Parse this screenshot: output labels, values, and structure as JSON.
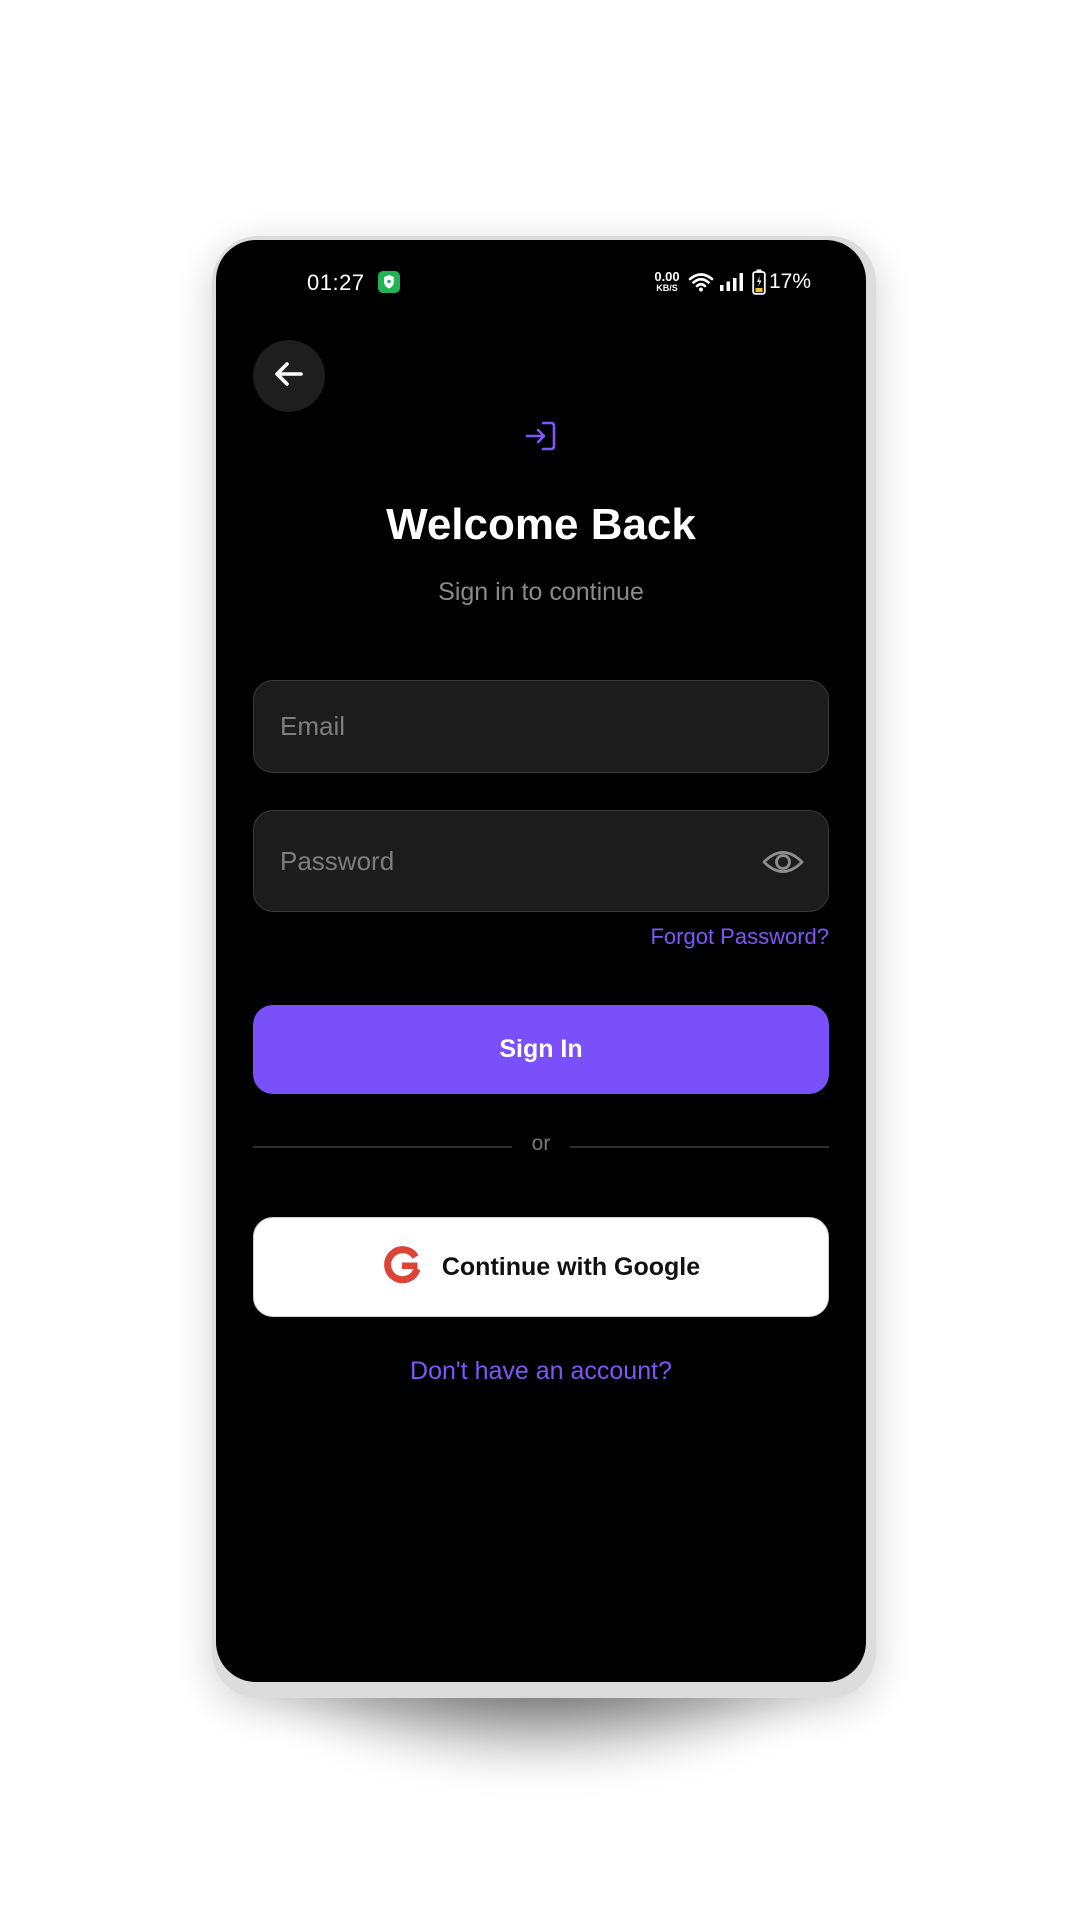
{
  "status_bar": {
    "time": "01:27",
    "net_speed_value": "0.00",
    "net_speed_unit": "KB/S",
    "battery": "17%"
  },
  "icons": {
    "back": "arrow-left-icon",
    "header": "login-icon",
    "password_toggle": "eye-icon",
    "google": "google-icon",
    "shield": "shield-icon",
    "wifi": "wifi-icon",
    "signal": "signal-icon",
    "battery": "battery-icon"
  },
  "colors": {
    "accent": "#7A50FB",
    "link": "#7F56FA",
    "background": "#000000",
    "field_background": "#1C1C1C",
    "google_red": "#DB4437"
  },
  "header": {
    "title": "Welcome Back",
    "subtitle": "Sign in to continue"
  },
  "form": {
    "email_placeholder": "Email",
    "email_value": "",
    "password_placeholder": "Password",
    "password_value": "",
    "forgot_label": "Forgot Password?",
    "submit_label": "Sign In",
    "divider_label": "or",
    "google_label": "Continue with Google",
    "signup_label": "Don't have an account?"
  }
}
